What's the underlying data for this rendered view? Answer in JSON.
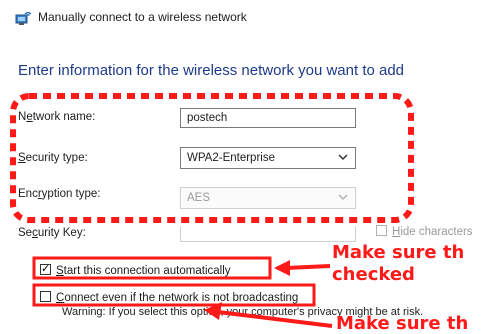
{
  "window": {
    "title": "Manually connect to a wireless network",
    "icon": "network-icon"
  },
  "heading": "Enter information for the wireless network you want to add",
  "form": {
    "network_name": {
      "label_pre": "N",
      "label_u": "e",
      "label_post": "twork name:",
      "value": "postech"
    },
    "security_type": {
      "label_u": "S",
      "label_post": "ecurity type:",
      "value": "WPA2-Enterprise"
    },
    "encryption_type": {
      "label_pre": "Enc",
      "label_u": "r",
      "label_post": "yption type:",
      "value": "AES",
      "disabled": true
    },
    "security_key": {
      "label_pre": "Se",
      "label_u": "c",
      "label_post": "urity Key:",
      "value": ""
    },
    "hide_characters": {
      "label_u": "H",
      "label_post": "ide characters",
      "checked": false
    }
  },
  "options": {
    "start_automatically": {
      "label_u": "S",
      "label_post": "tart this connection automatically",
      "checked": true
    },
    "connect_even": {
      "label_u": "C",
      "label_post": "onnect even if the network is not broadcasting",
      "checked": false
    },
    "warning": "Warning: If you select this option, your computer's privacy might be at risk."
  },
  "annotations": {
    "callout_1_line1": "Make sure th",
    "callout_1_line2": "checked",
    "callout_2": "Make sure th",
    "color": "#ff1a1a"
  }
}
